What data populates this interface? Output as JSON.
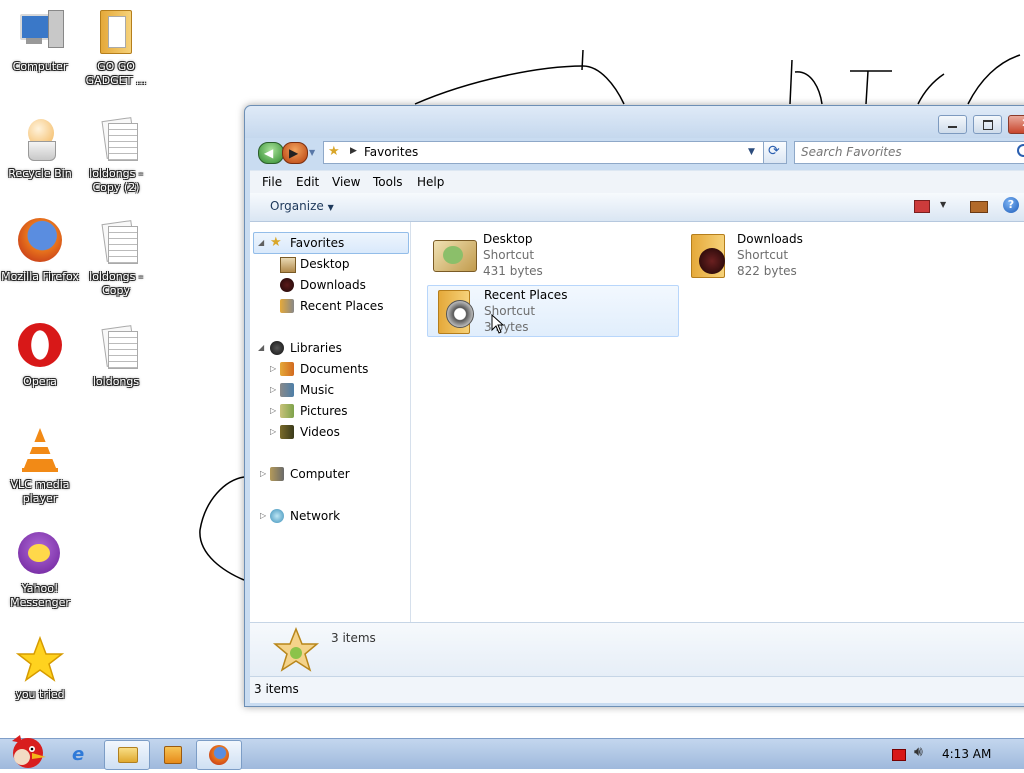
{
  "desktop": {
    "icons": [
      {
        "label": "Computer",
        "icon": "computer-icon"
      },
      {
        "label": "GO GO GADGET ...",
        "icon": "folder-icon"
      },
      {
        "label": "Recycle Bin",
        "icon": "recycle-bin-icon"
      },
      {
        "label": "loldongs - Copy (2)",
        "icon": "document-icon"
      },
      {
        "label": "Mozilla Firefox",
        "icon": "firefox-icon"
      },
      {
        "label": "loldongs - Copy",
        "icon": "document-icon"
      },
      {
        "label": "Opera",
        "icon": "opera-icon"
      },
      {
        "label": "loldongs",
        "icon": "document-icon"
      },
      {
        "label": "VLC media player",
        "icon": "vlc-icon"
      },
      {
        "label": "Yahoo! Messenger",
        "icon": "yahoo-messenger-icon"
      },
      {
        "label": "you tried",
        "icon": "star-icon"
      }
    ]
  },
  "explorer": {
    "address": {
      "crumb": "Favorites"
    },
    "search": {
      "placeholder": "Search Favorites"
    },
    "menu": [
      "File",
      "Edit",
      "View",
      "Tools",
      "Help"
    ],
    "toolbar": {
      "organize_label": "Organize"
    },
    "nav": {
      "favorites": {
        "label": "Favorites",
        "items": [
          "Desktop",
          "Downloads",
          "Recent Places"
        ]
      },
      "libraries": {
        "label": "Libraries",
        "items": [
          "Documents",
          "Music",
          "Pictures",
          "Videos"
        ]
      },
      "computer": "Computer",
      "network": "Network"
    },
    "files": [
      {
        "name": "Desktop",
        "type": "Shortcut",
        "size": "431 bytes"
      },
      {
        "name": "Downloads",
        "type": "Shortcut",
        "size": "822 bytes"
      },
      {
        "name": "Recent Places",
        "type": "Shortcut",
        "size": "3 bytes"
      }
    ],
    "details": {
      "count": "3 items"
    },
    "status": {
      "count": "3 items"
    }
  },
  "taskbar": {
    "clock": "4:13 AM"
  }
}
